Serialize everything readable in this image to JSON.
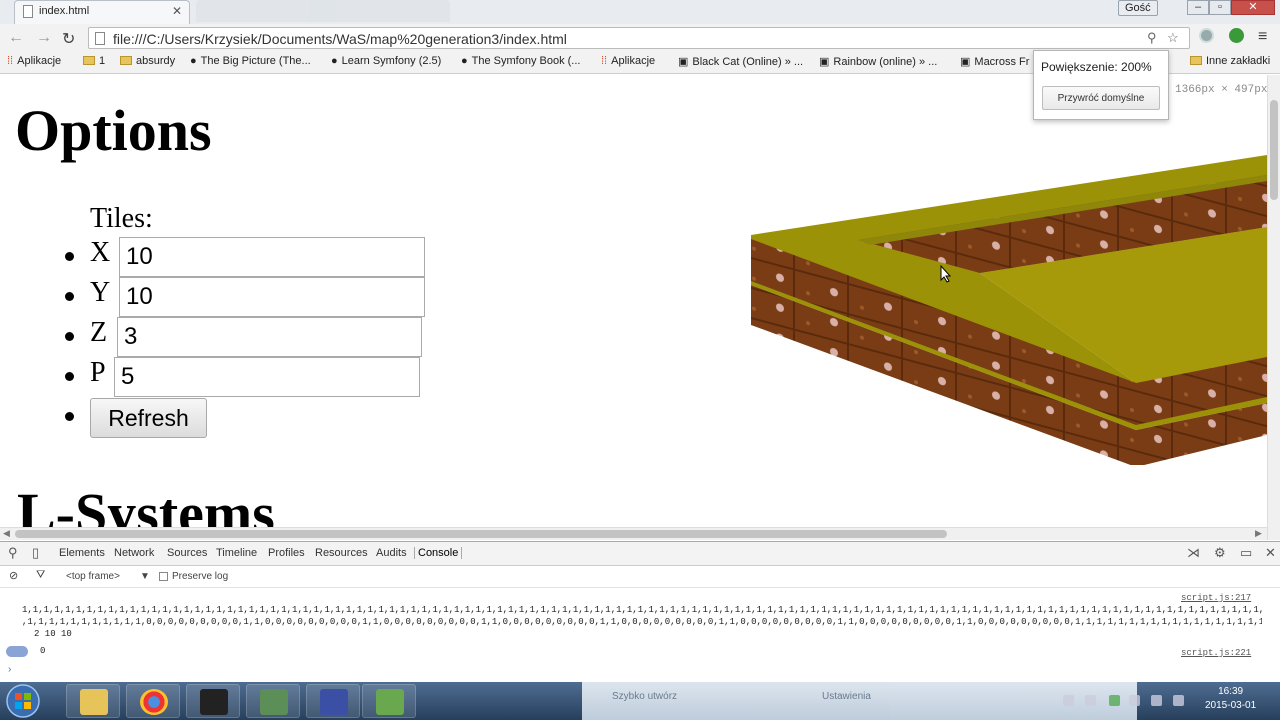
{
  "browser": {
    "tab_title": "index.html",
    "user_button": "Gość",
    "url": "file:///C:/Users/Krzysiek/Documents/WaS/map%20generation3/index.html",
    "bookmarks": [
      {
        "label": "Aplikacje",
        "icon": "apps-icon"
      },
      {
        "label": "1",
        "icon": "folder-icon"
      },
      {
        "label": "absurdy",
        "icon": "folder-icon"
      },
      {
        "label": "The Big Picture (The...",
        "icon": "site-icon"
      },
      {
        "label": "Learn Symfony (2.5)",
        "icon": "site-icon"
      },
      {
        "label": "The Symfony Book (...",
        "icon": "site-icon"
      },
      {
        "label": "Aplikacje",
        "icon": "apps-icon"
      },
      {
        "label": "Black Cat (Online) » ...",
        "icon": "site-icon"
      },
      {
        "label": "Rainbow (online) » ...",
        "icon": "site-icon"
      },
      {
        "label": "Macross Fr",
        "icon": "site-icon"
      }
    ],
    "other_bookmarks": "Inne zakładki",
    "zoom_popup": {
      "text": "Powiększenie: 200%",
      "reset_button": "Przywróć domyślne"
    },
    "viewport_size": "1366px × 497px"
  },
  "page": {
    "heading_options": "Options",
    "tiles_label": "Tiles:",
    "fields": [
      {
        "label": "X",
        "value": "10"
      },
      {
        "label": "Y",
        "value": "10"
      },
      {
        "label": "Z",
        "value": "3"
      },
      {
        "label": "P",
        "value": "5"
      }
    ],
    "refresh_button": "Refresh",
    "heading_lsystems": "L-Systems"
  },
  "devtools": {
    "tabs": [
      "Elements",
      "Network",
      "Sources",
      "Timeline",
      "Profiles",
      "Resources",
      "Audits",
      "Console"
    ],
    "active_tab": "Console",
    "frame_selector": "<top frame>",
    "preserve_log": "Preserve log",
    "console": {
      "source_1": "script.js:217",
      "line_1": "1,1,1,1,1,1,1,1,1,1,1,1,1,1,1,1,1,1,1,1,1,1,1,1,1,1,1,1,1,1,1,1,1,1,1,1,1,1,1,1,1,1,1,1,1,1,1,1,1,1,1,1,1,1,1,1,1,1,1,1,1,1,1,1,1,1,1,1,1,1,1,1,1,1,1,1,1,1,1,1,1,1,1,1,1,1,1,1,1,1,1,1,1,1,1,1,1,1,1,1,1,1,1,1,1,1,1,1,1,1,1,1,1,1,1,1,1,1,1,1,1,1,1,1,1,1,1,1,1,1,1,1,1,1,1,1,1,1,1,1,1,1",
      "line_2": ",1,1,1,1,1,1,1,1,1,1,1,0,0,0,0,0,0,0,0,0,1,1,0,0,0,0,0,0,0,0,0,1,1,0,0,0,0,0,0,0,0,0,1,1,0,0,0,0,0,0,0,0,0,1,1,0,0,0,0,0,0,0,0,0,1,1,0,0,0,0,0,0,0,0,0,1,1,0,0,0,0,0,0,0,0,0,1,1,0,0,0,0,0,0,0,0,0,1,1,1,1,1,1,1,1,1,1,1,1,1,1,1,1,1,1,1",
      "line_3": "2 10 10",
      "source_2": "script.js:221",
      "line_4": "0"
    }
  },
  "taskbar": {
    "background_items": [
      "Szybko utwórz",
      "Ustawienia"
    ],
    "clock_time": "16:39",
    "clock_date": "2015-03-01"
  },
  "colors": {
    "grass_top": "#9b9208",
    "dirt": "#7a3c14",
    "dirt_dark": "#5a2a0c",
    "taskbar": "#2c4a6e"
  }
}
